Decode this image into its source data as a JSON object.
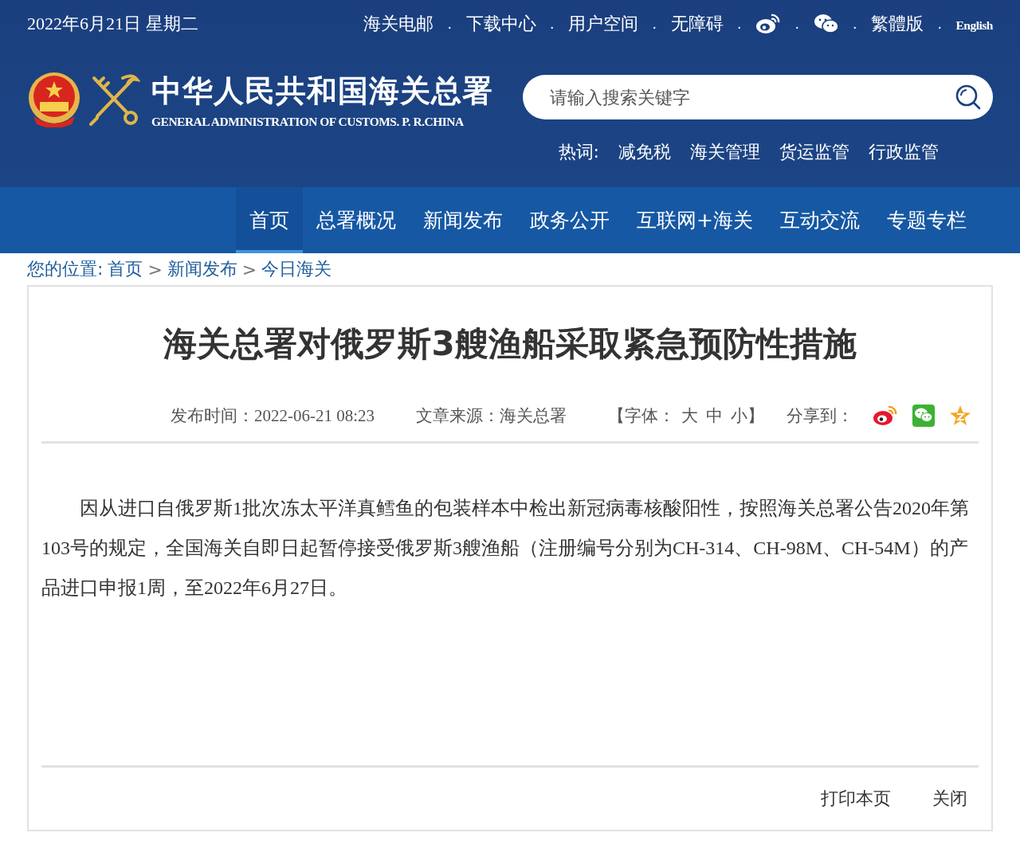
{
  "top_bar": {
    "date": "2022年6月21日 星期二",
    "links": [
      {
        "kind": "text",
        "label": "海关电邮"
      },
      {
        "kind": "text",
        "label": "下载中心"
      },
      {
        "kind": "text",
        "label": "用户空间"
      },
      {
        "kind": "text",
        "label": "无障碍"
      },
      {
        "kind": "weibo"
      },
      {
        "kind": "wechat"
      },
      {
        "kind": "text",
        "label": "繁體版"
      },
      {
        "kind": "text",
        "label": "English"
      }
    ],
    "separator": "."
  },
  "header": {
    "site_name": "中华人民共和国海关总署",
    "site_name_en": "GENERAL ADMINISTRATION OF CUSTOMS. P. R.CHINA",
    "search": {
      "placeholder": "请输入搜索关键字"
    },
    "hot_words_label": "热词:",
    "hot_words": [
      "减免税",
      "海关管理",
      "货运监管",
      "行政监管"
    ]
  },
  "nav": [
    {
      "label": "首页",
      "selected": true
    },
    {
      "label": "总署概况",
      "selected": false
    },
    {
      "label": "新闻发布",
      "selected": false
    },
    {
      "label": "政务公开",
      "selected": false
    },
    {
      "label": "互联网+海关",
      "selected": false
    },
    {
      "label": "互动交流",
      "selected": false
    },
    {
      "label": "专题专栏",
      "selected": false
    }
  ],
  "breadcrumb": {
    "label": "您的位置:",
    "items": [
      "首页",
      "新闻发布",
      "今日海关"
    ],
    "separator": ">"
  },
  "article": {
    "title": "海关总署对俄罗斯3艘渔船采取紧急预防性措施",
    "publish_time": "发布时间：2022-06-21 08:23",
    "source": "文章来源：海关总署",
    "font_size_label": "【字体：",
    "font_sizes": [
      "大",
      "中",
      "小】"
    ],
    "share_label": "分享到：",
    "share": [
      {
        "kind": "weibo"
      },
      {
        "kind": "wechat"
      },
      {
        "kind": "qzone"
      }
    ],
    "body": "因从进口自俄罗斯1批次冻太平洋真鳕鱼的包装样本中检出新冠病毒核酸阳性，按照海关总署公告2020年第103号的规定，全国海关自即日起暂停接受俄罗斯3艘渔船（注册编号分别为CH-314、CH-98M、CH-54M）的产品进口申报1周，至2022年6月27日。",
    "actions": [
      "打印本页",
      "关闭"
    ]
  }
}
